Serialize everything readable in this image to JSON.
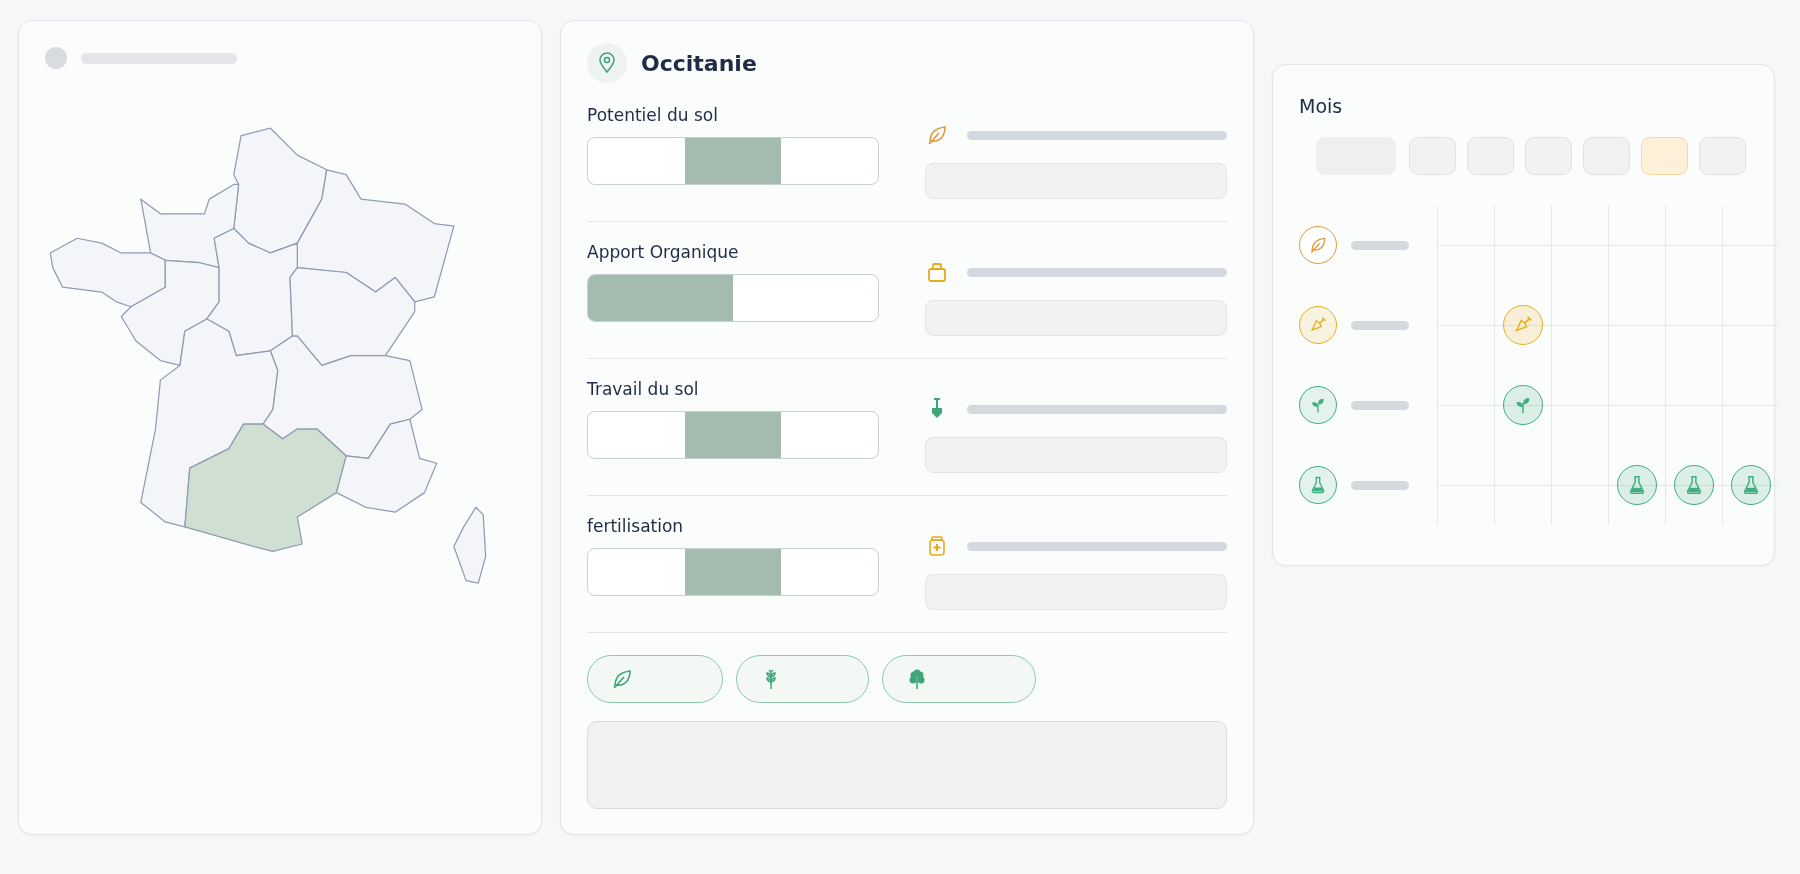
{
  "map": {
    "regions": [
      {
        "selected": false
      },
      {
        "selected": false
      },
      {
        "selected": false
      },
      {
        "selected": false
      },
      {
        "selected": false
      },
      {
        "selected": false
      },
      {
        "selected": false
      },
      {
        "selected": false
      },
      {
        "selected": false
      },
      {
        "selected": true
      },
      {
        "selected": false
      },
      {
        "selected": false
      }
    ]
  },
  "detail": {
    "title": "Occitanie",
    "criteria": [
      {
        "label": "Potentiel du sol",
        "kind": "segments",
        "color": "#e39a3b",
        "segments": [
          {
            "selected": false
          },
          {
            "selected": true
          },
          {
            "selected": false
          }
        ]
      },
      {
        "label": "Apport Organique",
        "kind": "bar",
        "color": "#e8a920",
        "level": 0.5
      },
      {
        "label": "Travail du sol",
        "kind": "segments",
        "color": "#3fa57a",
        "segments": [
          {
            "selected": false
          },
          {
            "selected": true
          },
          {
            "selected": false
          }
        ]
      },
      {
        "label": "fertilisation",
        "kind": "segments",
        "color": "#e8a920",
        "segments": [
          {
            "selected": false
          },
          {
            "selected": true
          },
          {
            "selected": false
          }
        ]
      }
    ]
  },
  "schedule": {
    "title": "Mois",
    "months": [
      {
        "selected": false
      },
      {
        "selected": false
      },
      {
        "selected": false
      },
      {
        "selected": false
      },
      {
        "selected": true
      },
      {
        "selected": false
      }
    ],
    "activities": [
      {
        "color": "#e39a3b",
        "cells": [
          {
            "on": false
          },
          {
            "on": false
          },
          {
            "on": false
          },
          {
            "on": false
          },
          {
            "on": false
          },
          {
            "on": false
          }
        ]
      },
      {
        "color": "#e8b020",
        "cells": [
          {
            "on": false
          },
          {
            "on": true
          },
          {
            "on": false
          },
          {
            "on": false
          },
          {
            "on": false
          },
          {
            "on": false
          }
        ]
      },
      {
        "color": "#3fae80",
        "cells": [
          {
            "on": false
          },
          {
            "on": true
          },
          {
            "on": false
          },
          {
            "on": false
          },
          {
            "on": false
          },
          {
            "on": false
          }
        ]
      },
      {
        "color": "#3fae80",
        "cells": [
          {
            "on": false
          },
          {
            "on": false
          },
          {
            "on": false
          },
          {
            "on": true
          },
          {
            "on": true
          },
          {
            "on": true
          }
        ]
      }
    ]
  }
}
